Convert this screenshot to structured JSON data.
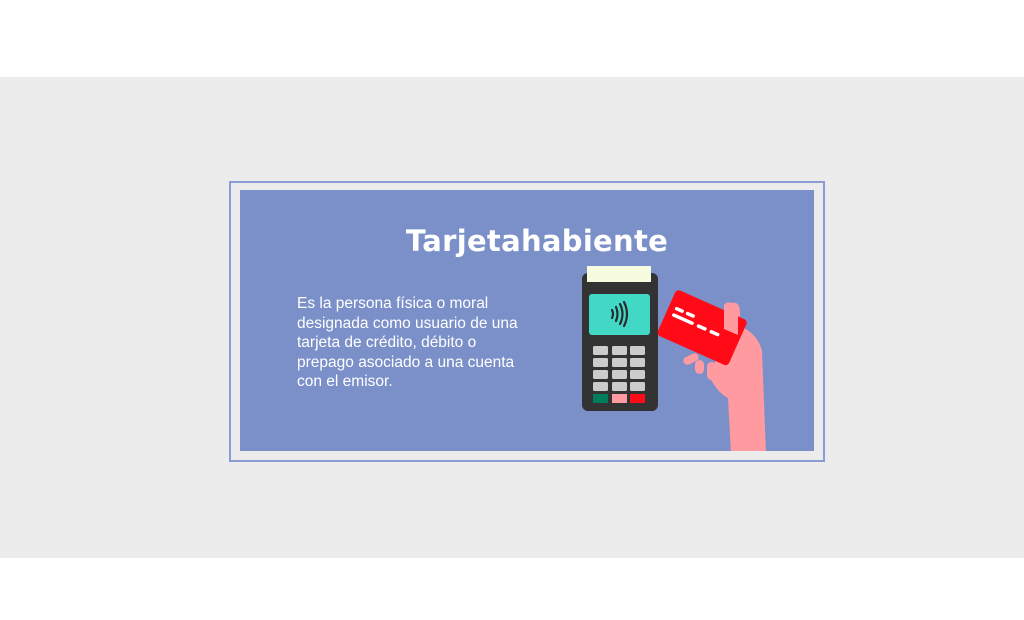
{
  "slide": {
    "title": "Tarjetahabiente",
    "description": "Es la persona física o moral designada como usuario de una tarjeta de crédito, débito o prepago asociado a una cuenta con el emisor.",
    "illustration": "payment-terminal-contactless-card-icon"
  },
  "colors": {
    "background_band": "#ececec",
    "panel": "#7b90c8",
    "frame_border": "#8b9bd3",
    "card": "#ff0a16",
    "terminal_screen": "#42d8c6",
    "hand": "#ff9aa0"
  }
}
